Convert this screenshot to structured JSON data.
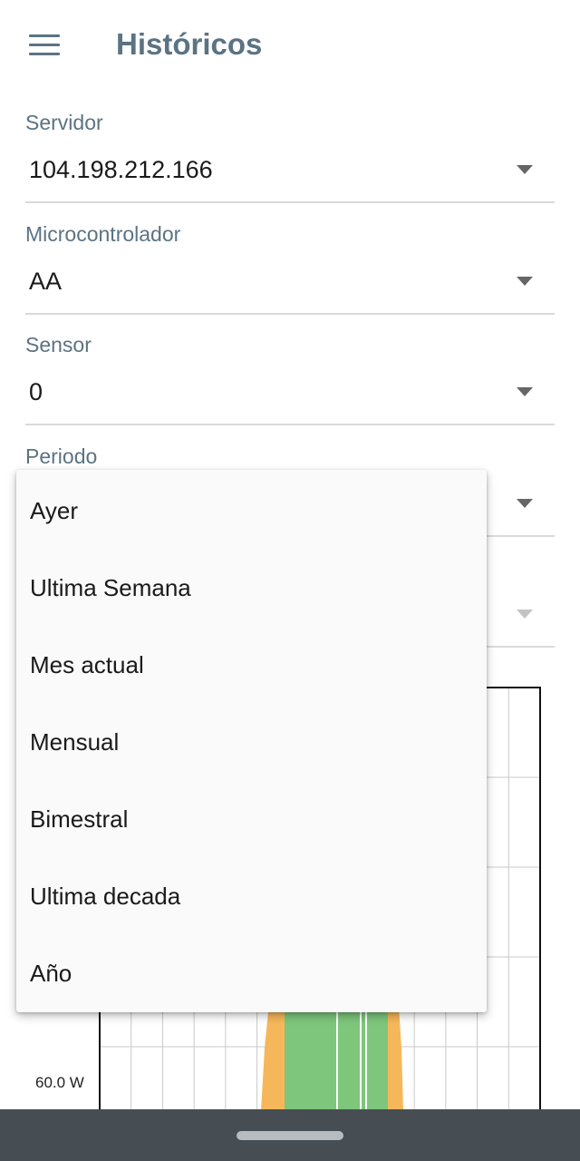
{
  "appbar": {
    "title": "Históricos",
    "menu_icon": "hamburger-menu-icon"
  },
  "fields": {
    "servidor": {
      "label": "Servidor",
      "value": "104.198.212.166"
    },
    "microcontrolador": {
      "label": "Microcontrolador",
      "value": "AA"
    },
    "sensor": {
      "label": "Sensor",
      "value": "0"
    },
    "periodo": {
      "label": "Periodo"
    }
  },
  "dropdown": {
    "items": [
      {
        "label": "Ayer"
      },
      {
        "label": "Ultima Semana"
      },
      {
        "label": "Mes actual"
      },
      {
        "label": "Mensual"
      },
      {
        "label": "Bimestral"
      },
      {
        "label": "Ultima decada"
      },
      {
        "label": "Año"
      }
    ]
  },
  "chart_data": {
    "type": "area",
    "y_tick_labels": [
      "60.0 W"
    ],
    "grid": true,
    "colors": {
      "green": "#7dc67b",
      "orange": "#f6b75a"
    }
  },
  "colors": {
    "accent": "#5b7383",
    "navbar": "#464e53"
  }
}
